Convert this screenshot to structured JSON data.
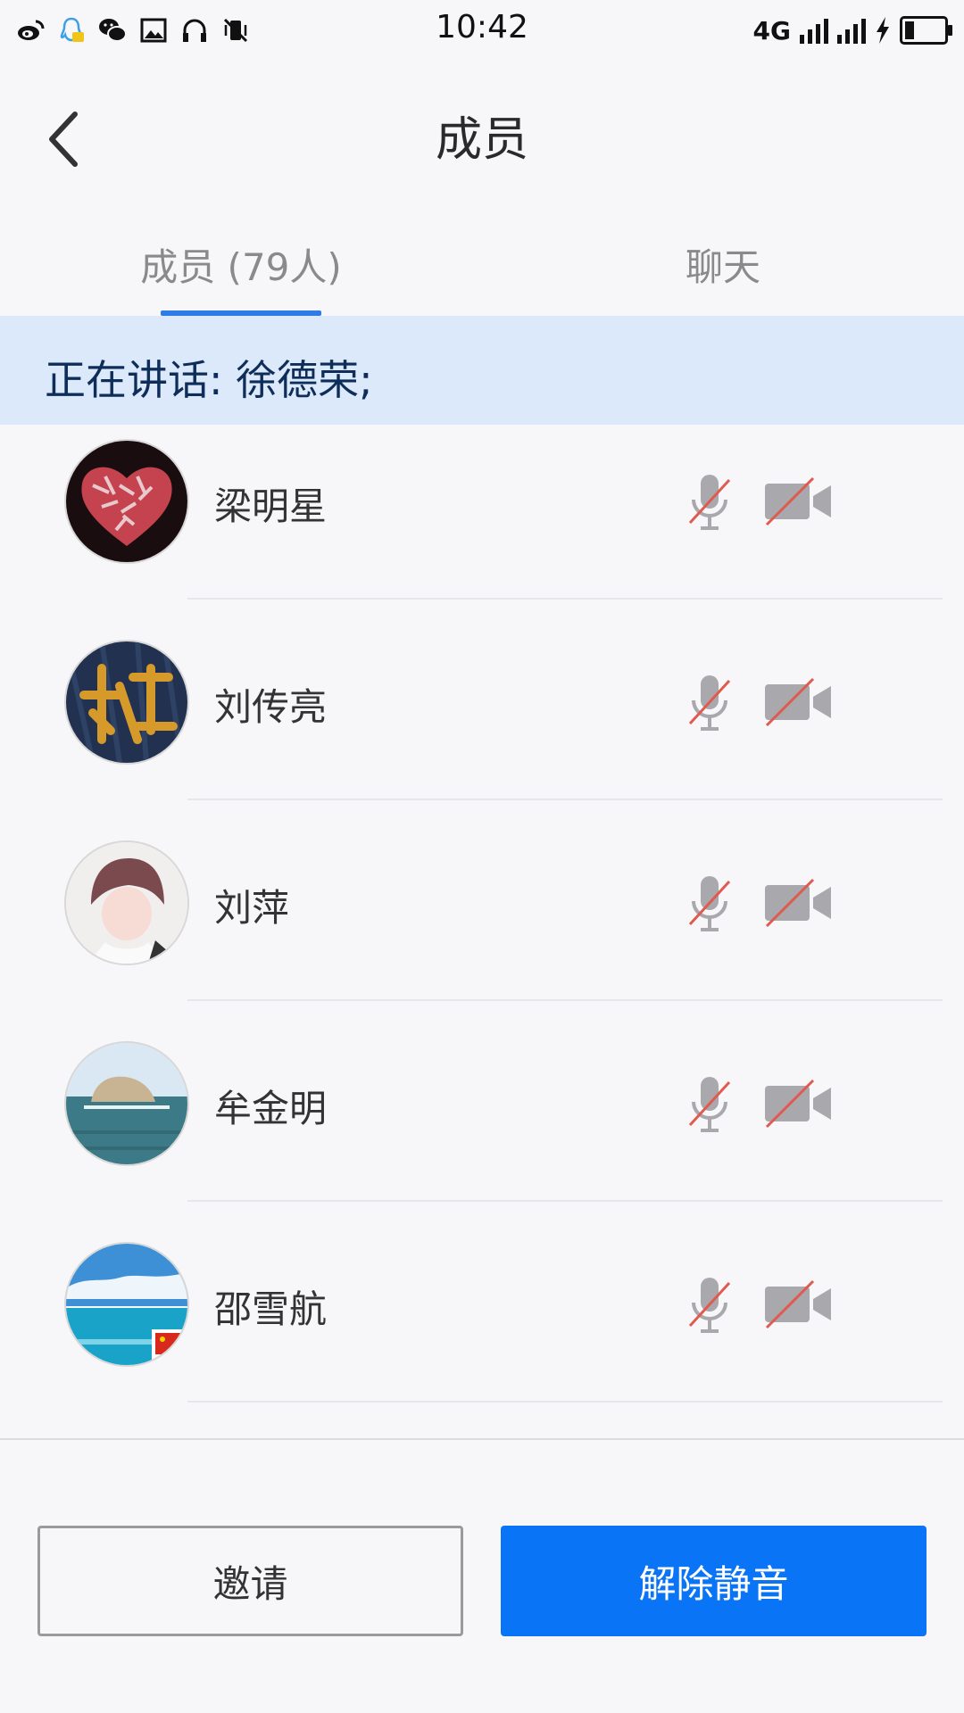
{
  "status_bar": {
    "time": "10:42",
    "network": "4G",
    "left_icons": [
      "weibo-icon",
      "qq-icon",
      "wechat-icon",
      "gallery-icon",
      "headphones-icon",
      "vibrate-off-icon"
    ]
  },
  "header": {
    "title": "成员"
  },
  "tabs": [
    {
      "label": "成员 (79人)",
      "active": true
    },
    {
      "label": "聊天",
      "active": false
    }
  ],
  "speaking": {
    "text": "正在讲话: 徐德荣;"
  },
  "members": [
    {
      "name": "梁明星",
      "mic": "muted",
      "camera": "off"
    },
    {
      "name": "刘传亮",
      "mic": "muted",
      "camera": "off"
    },
    {
      "name": "刘萍",
      "mic": "muted",
      "camera": "off"
    },
    {
      "name": "牟金明",
      "mic": "muted",
      "camera": "off"
    },
    {
      "name": "邵雪航",
      "mic": "muted",
      "camera": "off"
    }
  ],
  "actions": {
    "invite_label": "邀请",
    "unmute_label": "解除静音"
  },
  "colors": {
    "accent": "#0a74f7",
    "tab_indicator": "#2f7be6",
    "banner_bg": "#dbe9fb",
    "muted_slash": "#e05a4f"
  }
}
